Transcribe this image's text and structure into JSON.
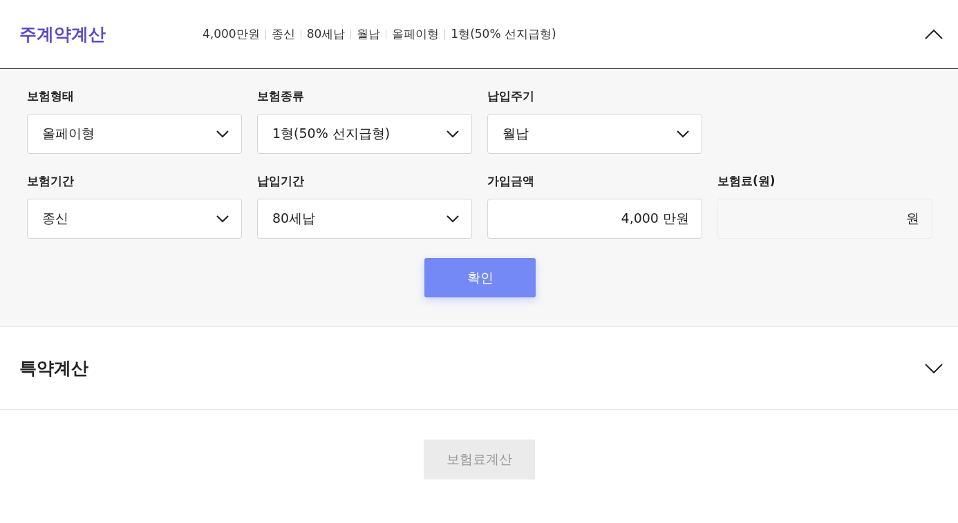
{
  "main_section": {
    "title": "주계약계산",
    "expanded": true,
    "summary": [
      "4,000만원",
      "종신",
      "80세납",
      "월납",
      "올페이형",
      "1형(50% 선지급형)"
    ],
    "fields": [
      {
        "label": "보험형태",
        "kind": "select",
        "value": "올페이형"
      },
      {
        "label": "보험종류",
        "kind": "select",
        "value": "1형(50% 선지급형)"
      },
      {
        "label": "납입주기",
        "kind": "select",
        "value": "월납"
      },
      {
        "label": "보험기간",
        "kind": "select",
        "value": "종신"
      },
      {
        "label": "납입기간",
        "kind": "select",
        "value": "80세납"
      },
      {
        "label": "가입금액",
        "kind": "input",
        "value": "4,000",
        "unit": "만원"
      },
      {
        "label": "보험료(원)",
        "kind": "readonly",
        "unit": "원"
      }
    ],
    "confirm_button": "확인"
  },
  "rider_section": {
    "title": "특약계산",
    "expanded": false
  },
  "calculate_button": {
    "label": "보험료계산",
    "disabled": true
  }
}
